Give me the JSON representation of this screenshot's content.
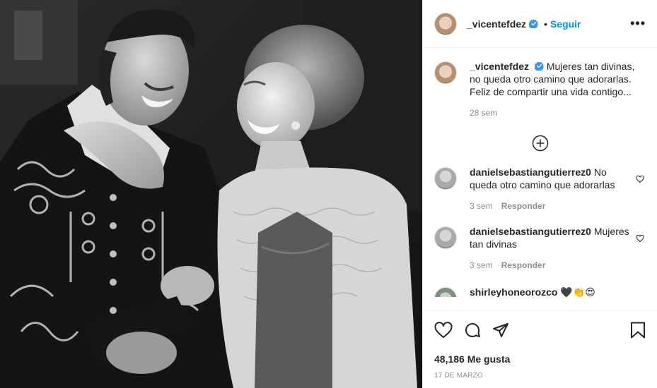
{
  "post": {
    "username": "_vicentefdez",
    "follow_label": "Seguir",
    "more_label": "•••",
    "separator": "•",
    "caption": {
      "username": "_vicentefdez",
      "text": "Mujeres tan divinas, no queda otro camino que adorarlas. Feliz de compartir una vida contigo...",
      "time": "28 sem"
    },
    "comments": [
      {
        "username": "danielsebastiangutierrez0",
        "text": "No queda otro camino que adorarlas",
        "time": "3 sem",
        "reply_label": "Responder"
      },
      {
        "username": "danielsebastiangutierrez0",
        "text": "Mujeres tan divinas",
        "time": "3 sem",
        "reply_label": "Responder"
      },
      {
        "username": "shirleyhoneorozco",
        "text": "🖤👏😍"
      }
    ],
    "likes": "48,186 Me gusta",
    "date": "17 de marzo"
  },
  "colors": {
    "accent": "#0095f6",
    "verified": "#3897f0",
    "muted": "#8e8e8e",
    "text": "#262626"
  },
  "icons": [
    "verified-badge-icon",
    "more-options-icon",
    "add-comment-icon",
    "heart-icon",
    "comment-icon",
    "share-icon",
    "bookmark-icon"
  ]
}
